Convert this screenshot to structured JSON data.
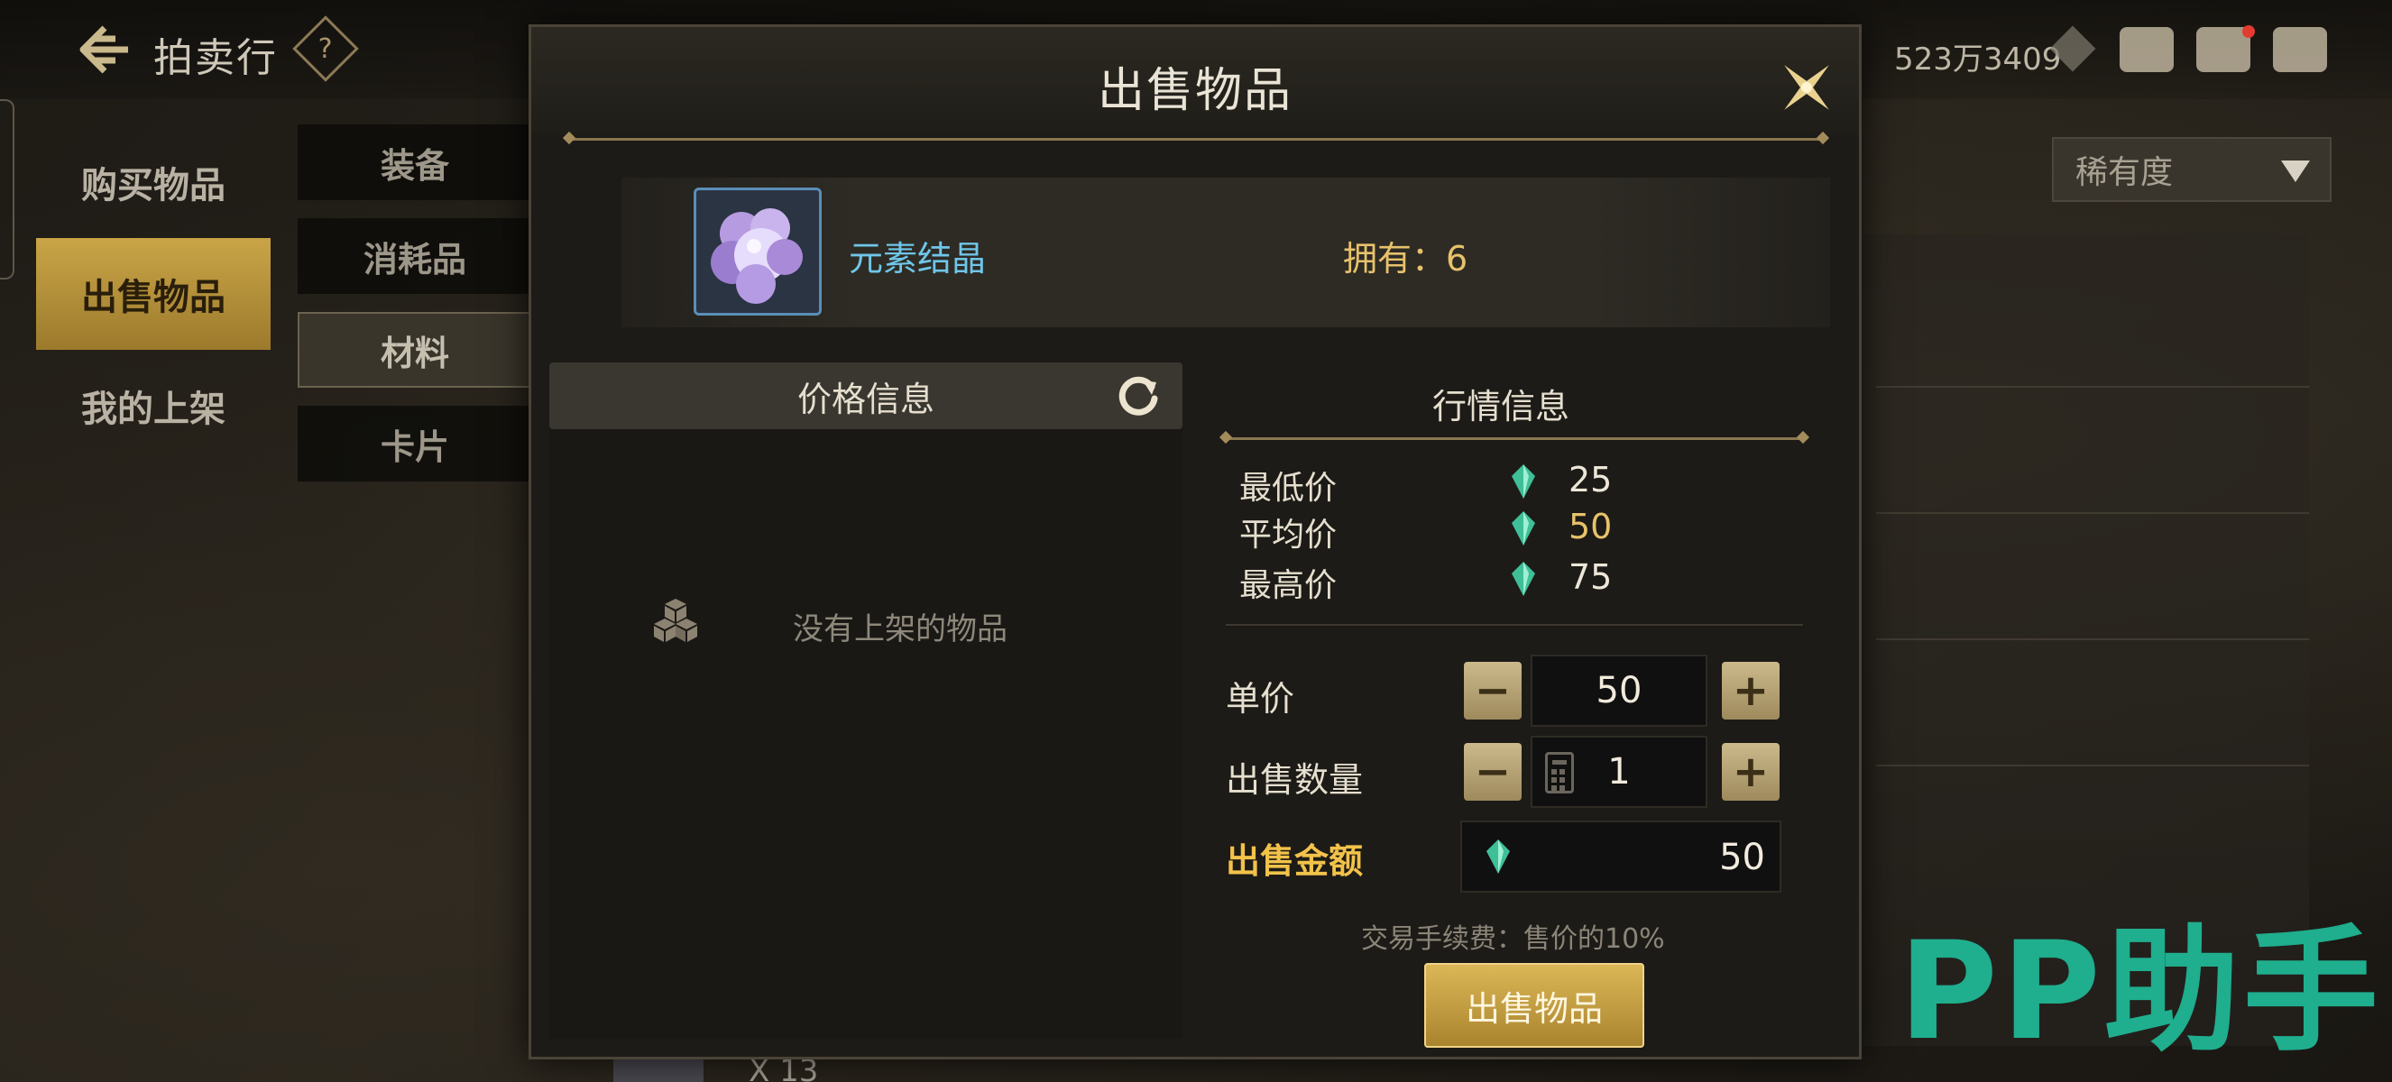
{
  "header": {
    "title": "拍卖行",
    "currency_amount": "523万3409"
  },
  "side_nav": {
    "items": [
      {
        "label": "购买物品"
      },
      {
        "label": "出售物品"
      },
      {
        "label": "我的上架"
      }
    ],
    "active_index": 1
  },
  "sub_nav": {
    "items": [
      {
        "label": "装备"
      },
      {
        "label": "消耗品"
      },
      {
        "label": "材料"
      },
      {
        "label": "卡片"
      }
    ],
    "active_index": 2
  },
  "filter": {
    "rarity_label": "稀有度"
  },
  "dialog": {
    "title": "出售物品",
    "item": {
      "name": "元素结晶",
      "owned_label": "拥有：6"
    },
    "price_info": {
      "title": "价格信息",
      "empty_text": "没有上架的物品"
    },
    "market_info": {
      "title": "行情信息",
      "min_label": "最低价",
      "min_value": "25",
      "avg_label": "平均价",
      "avg_value": "50",
      "max_label": "最高价",
      "max_value": "75"
    },
    "unit_price_label": "单价",
    "unit_price_value": "50",
    "quantity_label": "出售数量",
    "quantity_value": "1",
    "total_label": "出售金额",
    "total_value": "50",
    "fee_text": "交易手续费：售价的10%",
    "sell_button": "出售物品",
    "minus_symbol": "−",
    "plus_symbol": "+"
  },
  "background": {
    "bottom_count": "X 13"
  },
  "watermark": "PP助手",
  "colors": {
    "accent_gold": "#f2c24a",
    "item_name": "#6fc6e9",
    "owned": "#e7c26b",
    "average_price": "#e7c26b",
    "watermark": "#1fae8e"
  },
  "icons": [
    "back-arrow-icon",
    "help-icon",
    "diamond-icon",
    "chest-icon",
    "mail-icon",
    "chat-icon",
    "close-icon",
    "refresh-icon",
    "empty-box-icon",
    "gem-icon",
    "calculator-icon",
    "dropdown-arrow-icon"
  ]
}
